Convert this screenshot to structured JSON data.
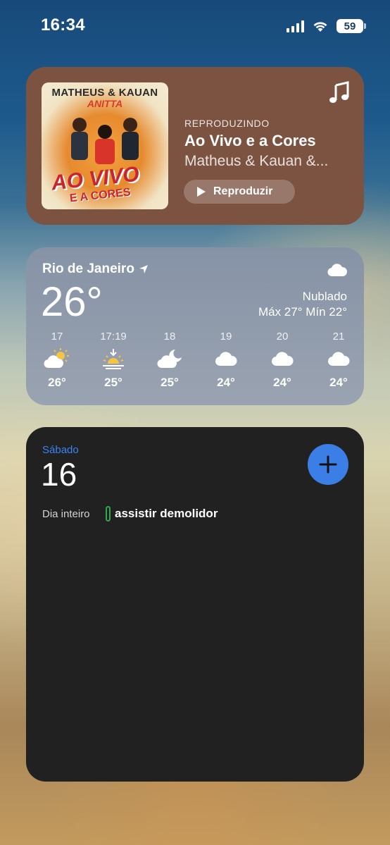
{
  "status_bar": {
    "time": "16:34",
    "battery": "59"
  },
  "music": {
    "status": "REPRODUZINDO",
    "title": "Ao Vivo e a Cores",
    "artist": "Matheus & Kauan &...",
    "play_label": "Reproduzir",
    "album_art": {
      "title": "MATHEUS & KAUAN",
      "subtitle": "ANITTA",
      "text_main": "AO VIVO",
      "text_sub": "E A CORES"
    },
    "background_color": "#7c5341"
  },
  "weather": {
    "city": "Rio de Janeiro",
    "temperature": "26°",
    "condition": "Nublado",
    "range": "Máx 27° Mín 22°",
    "forecast": [
      {
        "time": "17",
        "icon": "partly-cloudy-icon",
        "temp": "26°"
      },
      {
        "time": "17:19",
        "icon": "sunset-icon",
        "temp": "25°"
      },
      {
        "time": "18",
        "icon": "cloud-moon-icon",
        "temp": "25°"
      },
      {
        "time": "19",
        "icon": "cloud-icon",
        "temp": "24°"
      },
      {
        "time": "20",
        "icon": "cloud-icon",
        "temp": "24°"
      },
      {
        "time": "21",
        "icon": "cloud-icon",
        "temp": "24°"
      }
    ]
  },
  "calendar": {
    "weekday": "Sábado",
    "day": "16",
    "all_day_label": "Dia inteiro",
    "event_title": "assistir demolidor",
    "accent_color": "#3a7ee6",
    "event_color": "#2fa84f"
  }
}
